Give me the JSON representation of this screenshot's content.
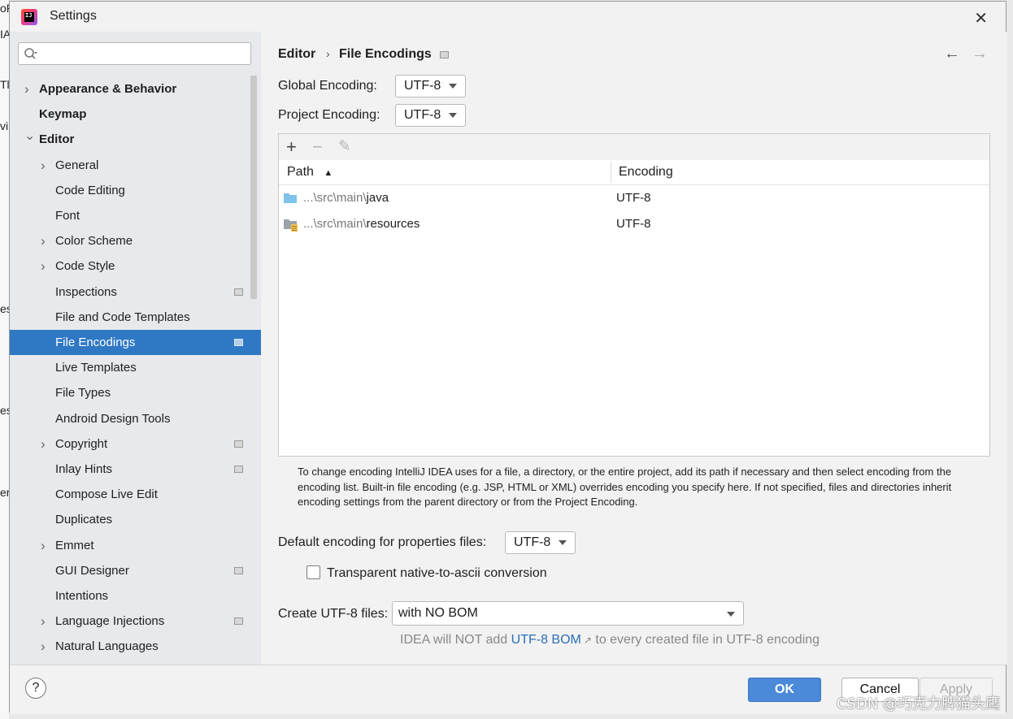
{
  "window": {
    "title": "Settings"
  },
  "background": {
    "fragments": [
      "oF",
      "IA",
      "Tl",
      "vi",
      "es",
      "es",
      "er"
    ]
  },
  "sidebar": {
    "search": {
      "placeholder": ""
    },
    "items": [
      {
        "label": "Appearance & Behavior",
        "level": 0,
        "expand": "collapsed",
        "bold": true,
        "marker": false
      },
      {
        "label": "Keymap",
        "level": 0,
        "expand": "none",
        "bold": true,
        "marker": false
      },
      {
        "label": "Editor",
        "level": 0,
        "expand": "expanded",
        "bold": true,
        "marker": false
      },
      {
        "label": "General",
        "level": 1,
        "expand": "collapsed",
        "marker": false
      },
      {
        "label": "Code Editing",
        "level": 1,
        "expand": "none",
        "marker": false
      },
      {
        "label": "Font",
        "level": 1,
        "expand": "none",
        "marker": false
      },
      {
        "label": "Color Scheme",
        "level": 1,
        "expand": "collapsed",
        "marker": false
      },
      {
        "label": "Code Style",
        "level": 1,
        "expand": "collapsed",
        "marker": false
      },
      {
        "label": "Inspections",
        "level": 1,
        "expand": "none",
        "marker": true
      },
      {
        "label": "File and Code Templates",
        "level": 1,
        "expand": "none",
        "marker": false
      },
      {
        "label": "File Encodings",
        "level": 1,
        "expand": "none",
        "marker": true,
        "selected": true
      },
      {
        "label": "Live Templates",
        "level": 1,
        "expand": "none",
        "marker": false
      },
      {
        "label": "File Types",
        "level": 1,
        "expand": "none",
        "marker": false
      },
      {
        "label": "Android Design Tools",
        "level": 1,
        "expand": "none",
        "marker": false
      },
      {
        "label": "Copyright",
        "level": 1,
        "expand": "collapsed",
        "marker": true
      },
      {
        "label": "Inlay Hints",
        "level": 1,
        "expand": "none",
        "marker": true
      },
      {
        "label": "Compose Live Edit",
        "level": 1,
        "expand": "none",
        "marker": false
      },
      {
        "label": "Duplicates",
        "level": 1,
        "expand": "none",
        "marker": false
      },
      {
        "label": "Emmet",
        "level": 1,
        "expand": "collapsed",
        "marker": false
      },
      {
        "label": "GUI Designer",
        "level": 1,
        "expand": "none",
        "marker": true
      },
      {
        "label": "Intentions",
        "level": 1,
        "expand": "none",
        "marker": false
      },
      {
        "label": "Language Injections",
        "level": 1,
        "expand": "collapsed",
        "marker": true
      },
      {
        "label": "Natural Languages",
        "level": 1,
        "expand": "collapsed",
        "marker": false
      }
    ]
  },
  "breadcrumb": {
    "parent": "Editor",
    "separator": "›",
    "current": "File Encodings"
  },
  "nav": {
    "back": "←",
    "forward": "→"
  },
  "global_encoding": {
    "label": "Global Encoding:",
    "value": "UTF-8"
  },
  "project_encoding": {
    "label": "Project Encoding:",
    "value": "UTF-8"
  },
  "table": {
    "toolbar": {
      "add": "+",
      "remove": "−",
      "edit": "✎"
    },
    "columns": [
      {
        "label": "Path",
        "sort": "▲"
      },
      {
        "label": "Encoding"
      }
    ],
    "rows": [
      {
        "path_prefix": "...\\src\\main\\",
        "path_name": "java",
        "encoding": "UTF-8",
        "icon": "source-folder-icon"
      },
      {
        "path_prefix": "...\\src\\main\\",
        "path_name": "resources",
        "encoding": "UTF-8",
        "icon": "resources-folder-icon"
      }
    ]
  },
  "help_text": "To change encoding IntelliJ IDEA uses for a file, a directory, or the entire project, add its path if necessary and then select encoding from the encoding list. Built-in file encoding (e.g. JSP, HTML or XML) overrides encoding you specify here. If not specified, files and directories inherit encoding settings from the parent directory or from the Project Encoding.",
  "properties_encoding": {
    "label": "Default encoding for properties files:",
    "value": "UTF-8"
  },
  "native_to_ascii": {
    "label": "Transparent native-to-ascii conversion",
    "checked": false
  },
  "create_utf8": {
    "label": "Create UTF-8 files:",
    "value": "with NO BOM"
  },
  "bom_note": {
    "prefix": "IDEA will NOT add ",
    "link": "UTF-8 BOM",
    "arrow": "↗",
    "suffix": " to every created file in UTF-8 encoding"
  },
  "footer": {
    "help": "?",
    "ok": "OK",
    "cancel": "Cancel",
    "apply": "Apply"
  },
  "watermark": "CSDN @巧克力脾猫头鹰",
  "colors": {
    "accent": "#2f78c4",
    "ok_button": "#4a8ad8",
    "link": "#2a6fb8",
    "sidebar_bg": "#e7e9ec",
    "folder": "#7ec3ea"
  }
}
